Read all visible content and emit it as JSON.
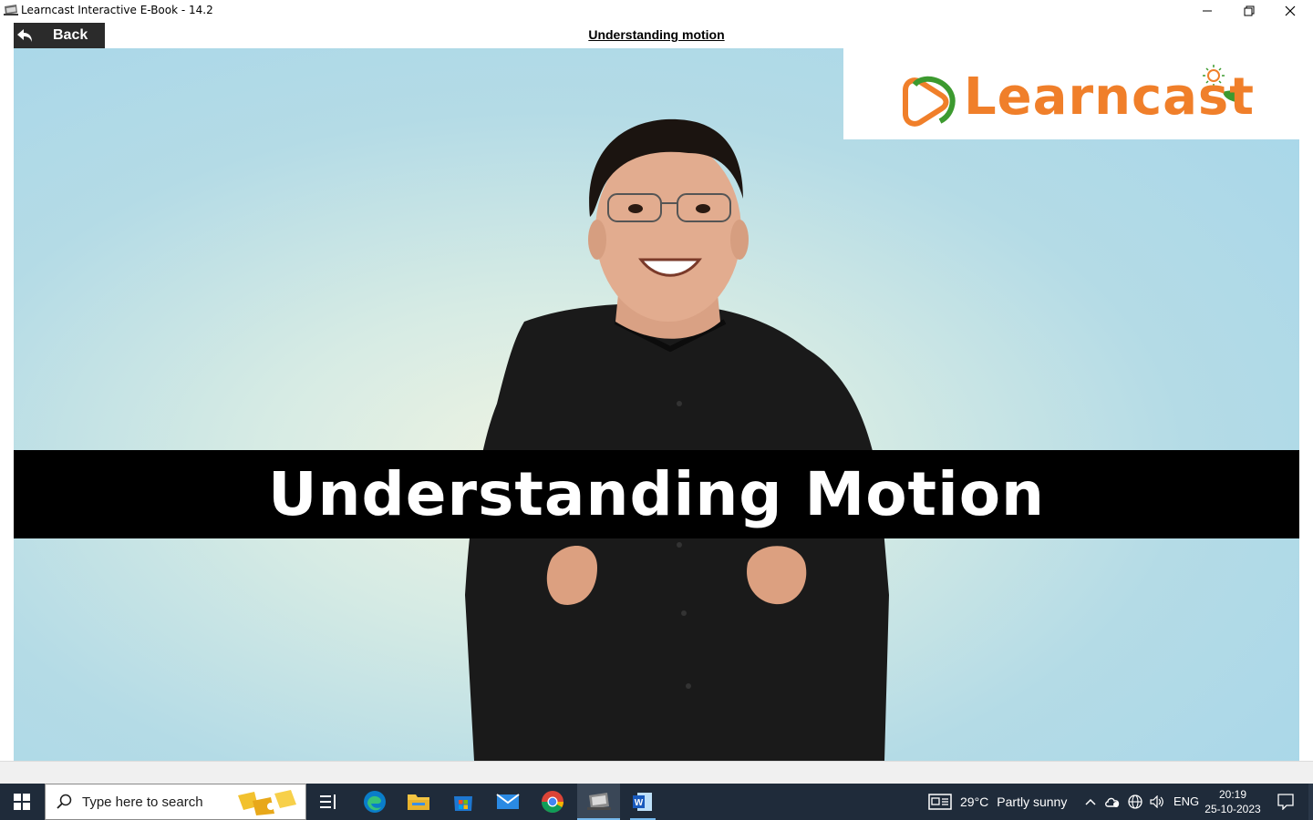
{
  "window": {
    "title": "Learncast Interactive E-Book - 14.2"
  },
  "header": {
    "back_label": "Back",
    "page_title": "Understanding motion"
  },
  "video": {
    "logo_text": "Learncast",
    "banner_text": "Understanding Motion"
  },
  "taskbar": {
    "search_placeholder": "Type here to search",
    "weather_temp": "29°C",
    "weather_desc": "Partly sunny",
    "language": "ENG",
    "time": "20:19",
    "date": "25-10-2023"
  },
  "colors": {
    "logo_orange": "#f07f2a",
    "logo_green": "#3c9a2f",
    "taskbar_bg": "#1f2b3a",
    "back_bg": "#2b2b2b"
  }
}
